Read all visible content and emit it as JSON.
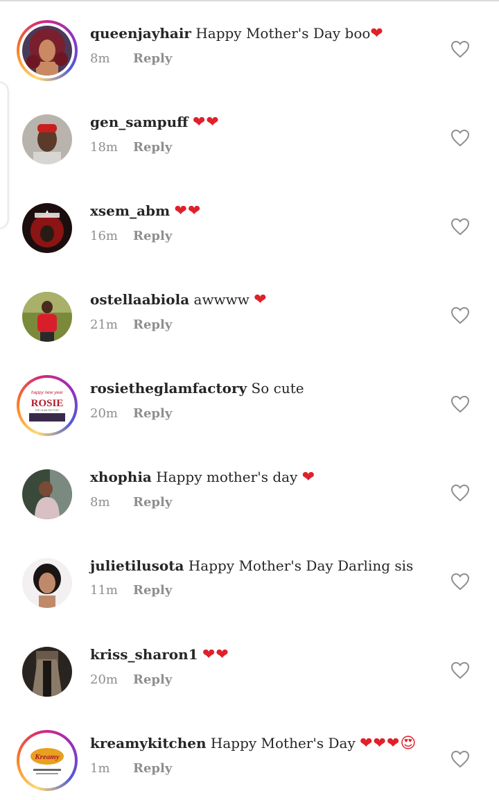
{
  "reply_label": "Reply",
  "comments": [
    {
      "username": "queenjayhair",
      "body": "Happy Mother's Day boo",
      "emoji": "❤",
      "time": "8m",
      "ring": true
    },
    {
      "username": "gen_sampuff",
      "body": "",
      "emoji": "❤❤",
      "time": "18m",
      "ring": false
    },
    {
      "username": "xsem_abm",
      "body": "",
      "emoji": "❤❤",
      "time": "16m",
      "ring": false
    },
    {
      "username": "ostellaabiola",
      "body": "awwww",
      "emoji": "❤",
      "time": "21m",
      "ring": false
    },
    {
      "username": "rosietheglamfactory",
      "body": "So cute",
      "emoji": "",
      "time": "20m",
      "ring": true,
      "avatar_text": {
        "top": "happy new year",
        "brand": "ROSIE",
        "tag": "THE GLAM FACTORY"
      }
    },
    {
      "username": "xhophia",
      "body": "Happy mother's day",
      "emoji": "❤",
      "time": "8m",
      "ring": false
    },
    {
      "username": "julietilusota",
      "body": "Happy Mother's Day Darling sis",
      "emoji": "",
      "time": "11m",
      "ring": false
    },
    {
      "username": "kriss_sharon1",
      "body": "",
      "emoji": "❤❤",
      "time": "20m",
      "ring": false
    },
    {
      "username": "kreamykitchen",
      "body": "Happy Mother's Day",
      "emoji": "❤❤❤😍",
      "time": "1m",
      "ring": true,
      "avatar_text": {
        "brand": "Kreamy"
      }
    }
  ],
  "colors": {
    "heart": "#e0202a",
    "muted": "#8e8e8e",
    "text": "#262626"
  },
  "icons": {
    "like": "heart-outline-icon"
  }
}
